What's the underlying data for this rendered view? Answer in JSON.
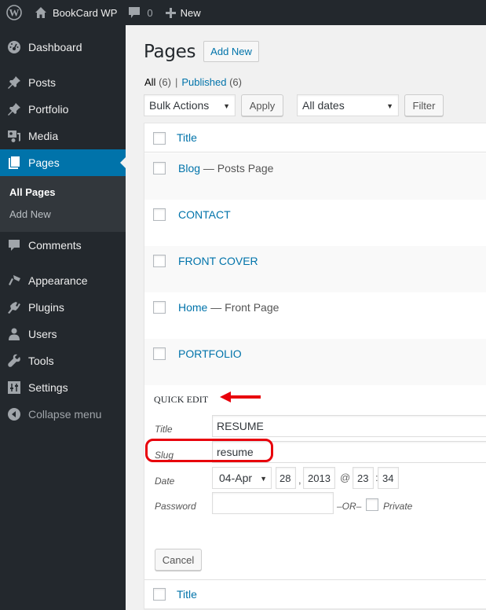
{
  "adminbar": {
    "site_name": "BookCard WP",
    "comments_count": "0",
    "new_label": "New"
  },
  "sidebar": {
    "items": [
      {
        "label": "Dashboard",
        "icon": "dashboard-icon"
      },
      {
        "label": "Posts",
        "icon": "pin-icon"
      },
      {
        "label": "Portfolio",
        "icon": "pin-icon"
      },
      {
        "label": "Media",
        "icon": "media-icon"
      },
      {
        "label": "Pages",
        "icon": "pages-icon",
        "current": true
      },
      {
        "label": "Comments",
        "icon": "comment-icon"
      },
      {
        "label": "Appearance",
        "icon": "brush-icon"
      },
      {
        "label": "Plugins",
        "icon": "plug-icon"
      },
      {
        "label": "Users",
        "icon": "user-icon"
      },
      {
        "label": "Tools",
        "icon": "wrench-icon"
      },
      {
        "label": "Settings",
        "icon": "sliders-icon"
      }
    ],
    "submenu": [
      "All Pages",
      "Add New"
    ],
    "collapse_label": "Collapse menu"
  },
  "main": {
    "title": "Pages",
    "add_new_label": "Add New",
    "filters": {
      "all_label": "All",
      "all_count": "(6)",
      "separator": "|",
      "published_label": "Published",
      "published_count": "(6)"
    },
    "bulk_actions": "Bulk Actions",
    "apply_label": "Apply",
    "dates_filter": "All dates",
    "filter_label": "Filter",
    "column_title": "Title",
    "rows": [
      {
        "title": "Blog",
        "state": " — Posts Page"
      },
      {
        "title": "CONTACT",
        "state": ""
      },
      {
        "title": "FRONT COVER",
        "state": ""
      },
      {
        "title": "Home",
        "state": " — Front Page"
      },
      {
        "title": "PORTFOLIO",
        "state": ""
      }
    ],
    "quick_edit": {
      "legend": "QUICK EDIT",
      "title_label": "Title",
      "title_value": "RESUME",
      "slug_label": "Slug",
      "slug_value": "resume",
      "date_label": "Date",
      "month": "04-Apr",
      "day": "28",
      "comma": ",",
      "year": "2013",
      "at": "@",
      "hour": "23",
      "colon": ":",
      "minute": "34",
      "password_label": "Password",
      "password_value": "",
      "or_label": "–OR–",
      "private_label": "Private",
      "cancel_label": "Cancel"
    }
  },
  "annotation_color": "#e8000b"
}
